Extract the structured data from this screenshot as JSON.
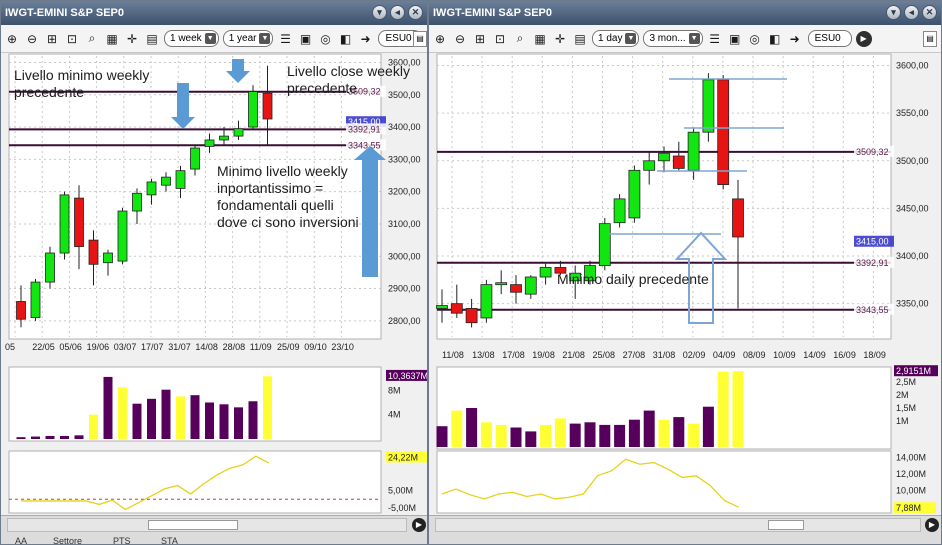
{
  "windows": [
    {
      "id": "weekly",
      "title": "IWGT-EMINI S&P SEP0",
      "window_buttons": [
        "▾",
        "◂",
        "✕"
      ],
      "toolbar": {
        "period": "1 week",
        "range": "1 year",
        "symbol": "ESU0"
      },
      "price_axis": {
        "ticks": [
          "3600,00",
          "3500,00",
          "3400,00",
          "3300,00",
          "3200,00",
          "3100,00",
          "3000,00",
          "2900,00",
          "2800,00"
        ],
        "min": 2750,
        "max": 3620
      },
      "price_tags": [
        {
          "text": "3509,32",
          "value": 3509.32,
          "color": "#5a1a4a",
          "bg": "#ffffff"
        },
        {
          "text": "3415,00",
          "value": 3415,
          "color": "#ffffff",
          "bg": "#2e2ec8"
        },
        {
          "text": "3392,91",
          "value": 3392.91,
          "color": "#5a1a4a",
          "bg": "#ffffff"
        },
        {
          "text": "3343,55",
          "value": 3343.55,
          "color": "#5a1a4a",
          "bg": "#ffffff"
        }
      ],
      "hlines": [
        {
          "value": 3509.32,
          "color": "#3a0e34"
        },
        {
          "value": 3392.91,
          "color": "#3a0e34"
        },
        {
          "value": 3343.55,
          "color": "#3a0e34"
        }
      ],
      "x_labels": [
        "05",
        "22/05",
        "05/06",
        "19/06",
        "03/07",
        "17/07",
        "31/07",
        "14/08",
        "28/08",
        "11/09",
        "25/09",
        "09/10",
        "23/10"
      ],
      "candles": [
        {
          "o": 2860,
          "h": 2910,
          "l": 2780,
          "c": 2805,
          "up": false
        },
        {
          "o": 2810,
          "h": 2930,
          "l": 2800,
          "c": 2920,
          "up": true
        },
        {
          "o": 2920,
          "h": 3030,
          "l": 2900,
          "c": 3010,
          "up": true
        },
        {
          "o": 3010,
          "h": 3200,
          "l": 2990,
          "c": 3190,
          "up": true
        },
        {
          "o": 3180,
          "h": 3220,
          "l": 2960,
          "c": 3030,
          "up": false
        },
        {
          "o": 3050,
          "h": 3080,
          "l": 2910,
          "c": 2975,
          "up": false
        },
        {
          "o": 2980,
          "h": 3020,
          "l": 2940,
          "c": 3010,
          "up": true
        },
        {
          "o": 2985,
          "h": 3150,
          "l": 2975,
          "c": 3140,
          "up": true
        },
        {
          "o": 3140,
          "h": 3210,
          "l": 3100,
          "c": 3195,
          "up": true
        },
        {
          "o": 3190,
          "h": 3240,
          "l": 3160,
          "c": 3230,
          "up": true
        },
        {
          "o": 3220,
          "h": 3260,
          "l": 3200,
          "c": 3245,
          "up": true
        },
        {
          "o": 3210,
          "h": 3280,
          "l": 3180,
          "c": 3265,
          "up": true
        },
        {
          "o": 3270,
          "h": 3345,
          "l": 3250,
          "c": 3335,
          "up": true
        },
        {
          "o": 3340,
          "h": 3380,
          "l": 3320,
          "c": 3360,
          "up": true
        },
        {
          "o": 3360,
          "h": 3400,
          "l": 3345,
          "c": 3372,
          "up": true
        },
        {
          "o": 3372,
          "h": 3420,
          "l": 3360,
          "c": 3395,
          "up": true
        },
        {
          "o": 3400,
          "h": 3530,
          "l": 3390,
          "c": 3510,
          "up": true
        },
        {
          "o": 3505,
          "h": 3590,
          "l": 3345,
          "c": 3425,
          "up": false
        }
      ],
      "volume": {
        "axis": [
          "10,3637M",
          "8M",
          "4M"
        ],
        "max": 11.5,
        "tag": "10,3637M",
        "bars": [
          {
            "v": 0.3,
            "c": "#56005c"
          },
          {
            "v": 0.4,
            "c": "#56005c"
          },
          {
            "v": 0.5,
            "c": "#56005c"
          },
          {
            "v": 0.5,
            "c": "#56005c"
          },
          {
            "v": 0.6,
            "c": "#56005c"
          },
          {
            "v": 4.0,
            "c": "#ffff33"
          },
          {
            "v": 10.2,
            "c": "#56005c"
          },
          {
            "v": 8.5,
            "c": "#ffff33"
          },
          {
            "v": 5.8,
            "c": "#56005c"
          },
          {
            "v": 6.6,
            "c": "#56005c"
          },
          {
            "v": 8.1,
            "c": "#56005c"
          },
          {
            "v": 7.0,
            "c": "#ffff33"
          },
          {
            "v": 7.2,
            "c": "#56005c"
          },
          {
            "v": 6.0,
            "c": "#56005c"
          },
          {
            "v": 5.7,
            "c": "#56005c"
          },
          {
            "v": 5.2,
            "c": "#56005c"
          },
          {
            "v": 6.2,
            "c": "#56005c"
          },
          {
            "v": 10.3,
            "c": "#ffff33"
          }
        ]
      },
      "osc": {
        "axis": [
          "5,00M",
          "-5,00M"
        ],
        "tag": "24,22M",
        "min": -8,
        "max": 28,
        "line": [
          -1,
          -1,
          -1,
          -1,
          -1,
          -1,
          -3,
          -0.5,
          -6,
          -2,
          2,
          6,
          8,
          3,
          9,
          14,
          18,
          20,
          25,
          21
        ],
        "dash": 0
      }
    },
    {
      "id": "daily",
      "title": "IWGT-EMINI S&P SEP0",
      "window_buttons": [
        "▾",
        "◂",
        "✕"
      ],
      "toolbar": {
        "period": "1 day",
        "range": "3 mon...",
        "symbol": "ESU0"
      },
      "price_axis": {
        "ticks": [
          "3600,00",
          "3550,00",
          "3500,00",
          "3450,00",
          "3400,00",
          "3350,00"
        ],
        "min": 3315,
        "max": 3610
      },
      "price_tags": [
        {
          "text": "3509,32",
          "value": 3509.32,
          "color": "#5a1a4a",
          "bg": "#ffffff"
        },
        {
          "text": "3415,00",
          "value": 3415,
          "color": "#ffffff",
          "bg": "#2e2ec8"
        },
        {
          "text": "3392,91",
          "value": 3392.91,
          "color": "#5a1a4a",
          "bg": "#ffffff"
        },
        {
          "text": "3343,55",
          "value": 3343.55,
          "color": "#5a1a4a",
          "bg": "#ffffff"
        }
      ],
      "hlines": [
        {
          "value": 3509.32,
          "color": "#3a0e34"
        },
        {
          "value": 3392.91,
          "color": "#3a0e34"
        },
        {
          "value": 3343.55,
          "color": "#3a0e34"
        }
      ],
      "x_labels": [
        "11/08",
        "13/08",
        "17/08",
        "19/08",
        "21/08",
        "25/08",
        "27/08",
        "31/08",
        "02/09",
        "04/09",
        "08/09",
        "10/09",
        "14/09",
        "16/09",
        "18/09"
      ],
      "candles": [
        {
          "o": 3345,
          "h": 3365,
          "l": 3330,
          "c": 3348,
          "up": true
        },
        {
          "o": 3350,
          "h": 3370,
          "l": 3335,
          "c": 3340,
          "up": false
        },
        {
          "o": 3345,
          "h": 3355,
          "l": 3325,
          "c": 3330,
          "up": false
        },
        {
          "o": 3335,
          "h": 3375,
          "l": 3330,
          "c": 3370,
          "up": true
        },
        {
          "o": 3370,
          "h": 3385,
          "l": 3360,
          "c": 3372,
          "up": true
        },
        {
          "o": 3370,
          "h": 3380,
          "l": 3350,
          "c": 3362,
          "up": false
        },
        {
          "o": 3360,
          "h": 3380,
          "l": 3355,
          "c": 3378,
          "up": true
        },
        {
          "o": 3378,
          "h": 3392,
          "l": 3370,
          "c": 3388,
          "up": true
        },
        {
          "o": 3388,
          "h": 3395,
          "l": 3380,
          "c": 3382,
          "up": false
        },
        {
          "o": 3382,
          "h": 3390,
          "l": 3355,
          "c": 3374,
          "up": true
        },
        {
          "o": 3374,
          "h": 3395,
          "l": 3370,
          "c": 3390,
          "up": true
        },
        {
          "o": 3390,
          "h": 3440,
          "l": 3385,
          "c": 3434,
          "up": true
        },
        {
          "o": 3435,
          "h": 3465,
          "l": 3430,
          "c": 3460,
          "up": true
        },
        {
          "o": 3440,
          "h": 3495,
          "l": 3435,
          "c": 3490,
          "up": true
        },
        {
          "o": 3490,
          "h": 3510,
          "l": 3475,
          "c": 3500,
          "up": true
        },
        {
          "o": 3500,
          "h": 3515,
          "l": 3488,
          "c": 3508,
          "up": true
        },
        {
          "o": 3505,
          "h": 3520,
          "l": 3490,
          "c": 3492,
          "up": false
        },
        {
          "o": 3490,
          "h": 3535,
          "l": 3480,
          "c": 3530,
          "up": true
        },
        {
          "o": 3530,
          "h": 3592,
          "l": 3520,
          "c": 3585,
          "up": true
        },
        {
          "o": 3585,
          "h": 3590,
          "l": 3470,
          "c": 3475,
          "up": false
        },
        {
          "o": 3460,
          "h": 3480,
          "l": 3345,
          "c": 3420,
          "up": false
        }
      ],
      "volume": {
        "axis": [
          "2,5M",
          "2M",
          "1,5M",
          "1M"
        ],
        "max": 3.0,
        "tag": "2,9151M",
        "bars": [
          {
            "v": 0.8,
            "c": "#56005c"
          },
          {
            "v": 1.4,
            "c": "#ffff33"
          },
          {
            "v": 1.5,
            "c": "#56005c"
          },
          {
            "v": 0.95,
            "c": "#ffff33"
          },
          {
            "v": 0.85,
            "c": "#ffff33"
          },
          {
            "v": 0.75,
            "c": "#56005c"
          },
          {
            "v": 0.6,
            "c": "#56005c"
          },
          {
            "v": 0.85,
            "c": "#ffff33"
          },
          {
            "v": 1.1,
            "c": "#ffff33"
          },
          {
            "v": 0.9,
            "c": "#56005c"
          },
          {
            "v": 0.95,
            "c": "#56005c"
          },
          {
            "v": 0.85,
            "c": "#56005c"
          },
          {
            "v": 0.85,
            "c": "#56005c"
          },
          {
            "v": 1.05,
            "c": "#56005c"
          },
          {
            "v": 1.4,
            "c": "#56005c"
          },
          {
            "v": 1.05,
            "c": "#ffff33"
          },
          {
            "v": 1.15,
            "c": "#56005c"
          },
          {
            "v": 0.9,
            "c": "#ffff33"
          },
          {
            "v": 1.55,
            "c": "#56005c"
          },
          {
            "v": 2.9,
            "c": "#ffff33"
          },
          {
            "v": 2.92,
            "c": "#ffff33"
          }
        ]
      },
      "osc": {
        "axis": [
          "14,00M",
          "12,00M",
          "10,00M"
        ],
        "tag": "7,88M",
        "min": 7.3,
        "max": 14.8,
        "line": [
          9.6,
          10.2,
          9.5,
          9.0,
          9.6,
          9.8,
          9.3,
          9.6,
          9.0,
          9.2,
          9.6,
          11.8,
          12.4,
          13.8,
          13.2,
          13.4,
          12.6,
          11.6,
          11.8,
          10.6,
          8.8,
          8.0
        ],
        "dash": null
      }
    }
  ],
  "annotations": {
    "weekly_low_prev": "Livello minimo weekly precedente",
    "weekly_close_prev": "Livello close weekly precedente",
    "weekly_min_note": "Minimo livello weekly inportantissimo = fondamentali quelli dove ci sono inversioni",
    "daily_min_prev": "Minimo daily precedente"
  },
  "colors": {
    "up": "#11e611",
    "down": "#e81414",
    "grid": "#c9c9c9",
    "arrow": "#5b9bd5",
    "hl_blue": "#7ea6d4"
  },
  "statusbar": {
    "left_text": [
      "AA",
      "Settore",
      "PTS",
      "STA"
    ]
  }
}
